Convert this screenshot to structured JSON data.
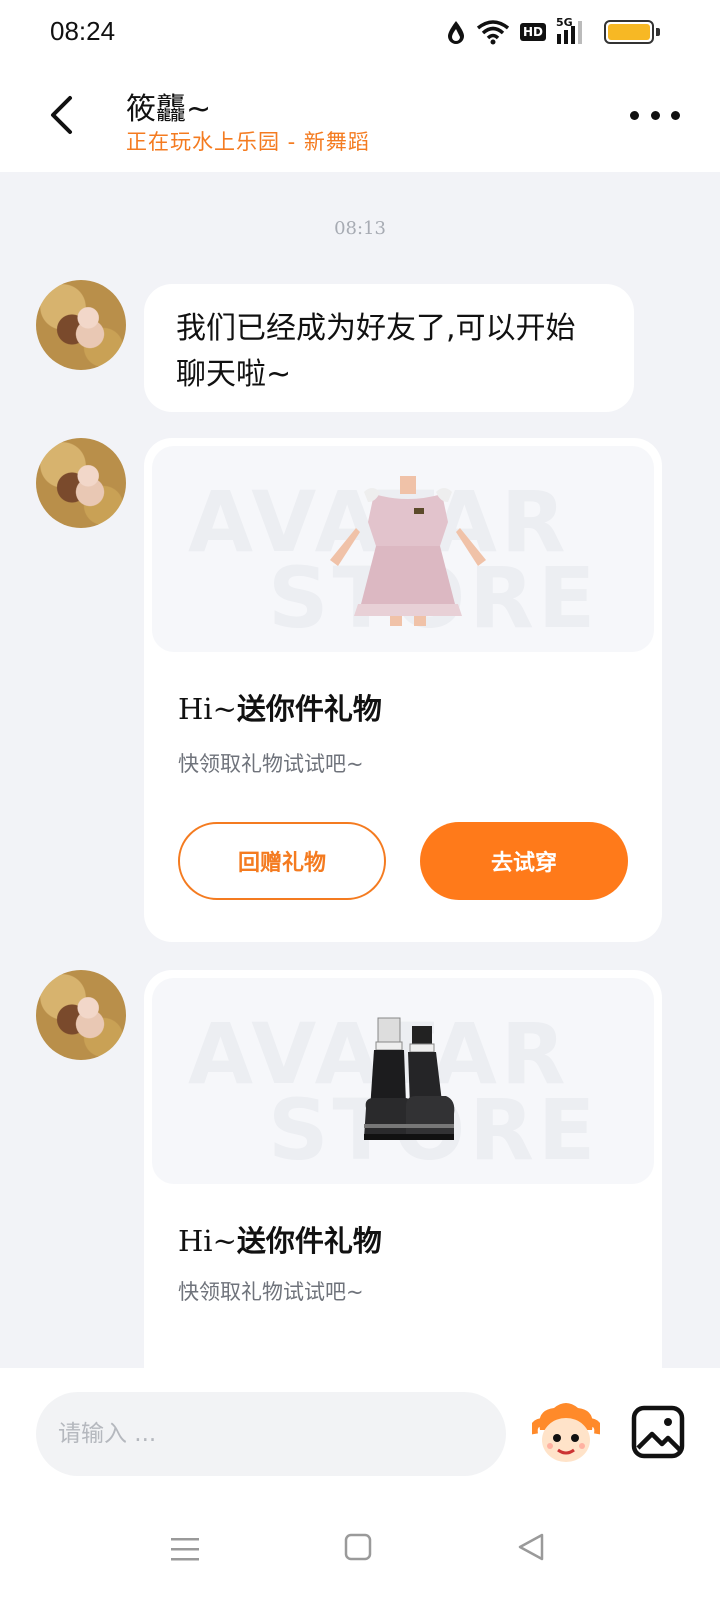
{
  "status_bar": {
    "time": "08:24",
    "hd_label": "HD",
    "network_label": "5G",
    "battery_color": "#f7b824"
  },
  "header": {
    "contact_name": "筱龘~",
    "contact_status": "正在玩水上乐园 - 新舞蹈"
  },
  "chat": {
    "timestamp": "08:13",
    "messages": [
      {
        "type": "text",
        "text": "我们已经成为好友了,可以开始聊天啦~"
      },
      {
        "type": "gift",
        "image": "dress-icon",
        "watermark_top": "AVATAR",
        "watermark_bottom": "STORE",
        "title_prefix": "Hi~",
        "title": "送你件礼物",
        "subtitle": "快领取礼物试试吧~",
        "return_gift_label": "回赠礼物",
        "try_on_label": "去试穿"
      },
      {
        "type": "gift",
        "image": "boots-icon",
        "watermark_top": "AVATAR",
        "watermark_bottom": "STORE",
        "title_prefix": "Hi~",
        "title": "送你件礼物",
        "subtitle": "快领取礼物试试吧~"
      }
    ]
  },
  "input": {
    "placeholder": "请输入 ..."
  },
  "colors": {
    "accent": "#ff7a1a",
    "accent_text": "#f47b20",
    "background": "#f2f3f7"
  }
}
